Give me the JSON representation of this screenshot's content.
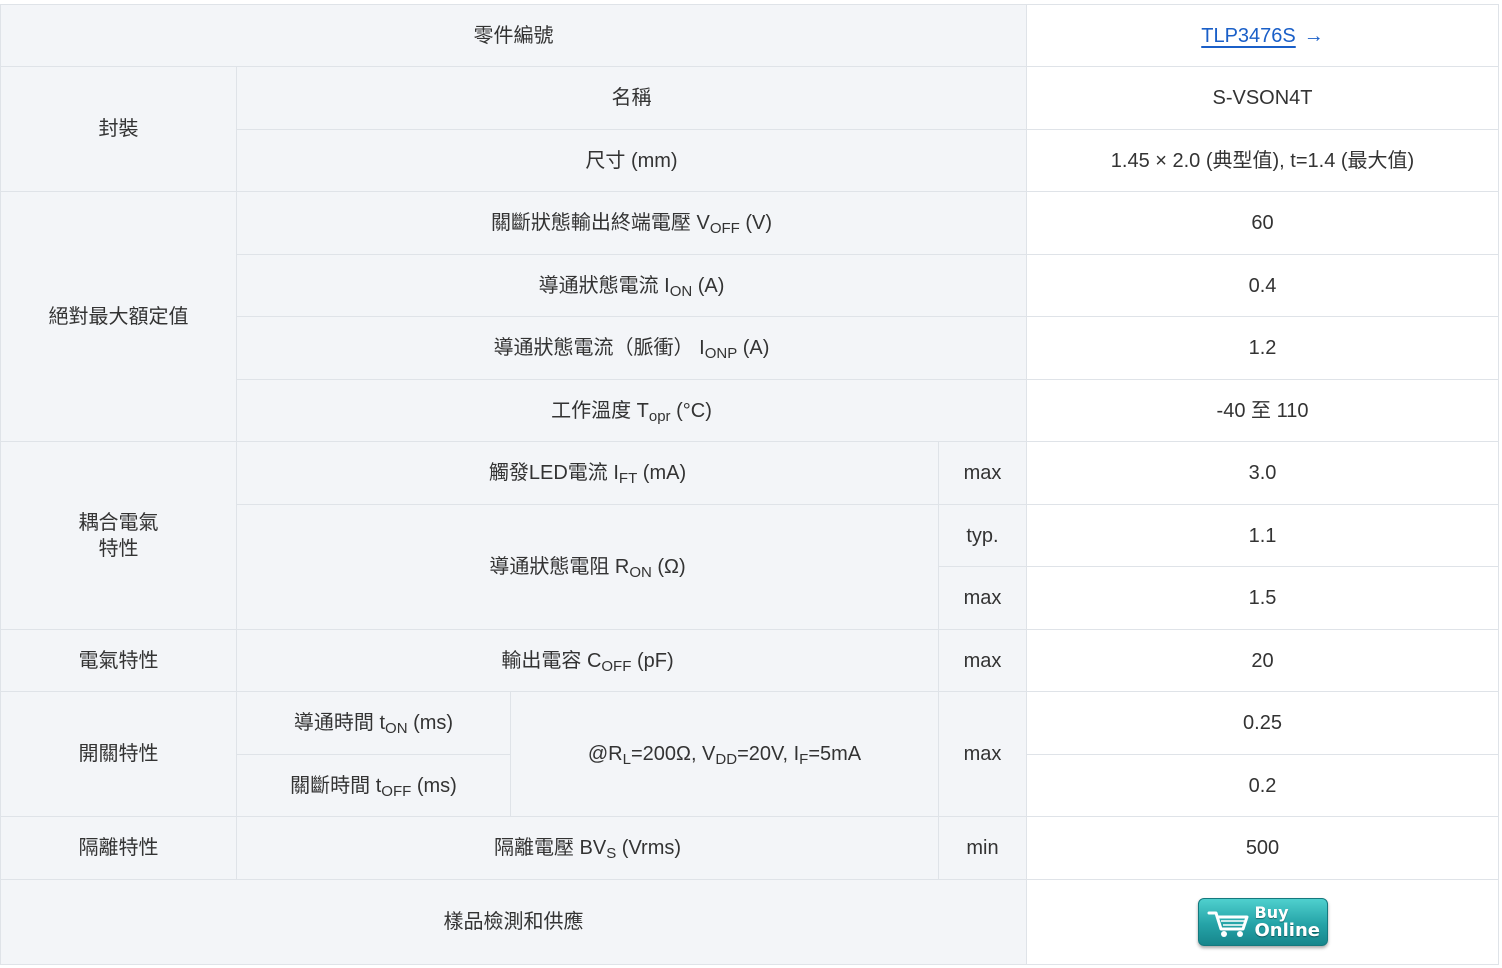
{
  "header": {
    "part_number_label": "零件編號",
    "part_number": "TLP3476S",
    "arrow": "→"
  },
  "package": {
    "group_label": "封裝",
    "name_label": "名稱",
    "name_value": "S-VSON4T",
    "size_label": "尺寸 (mm)",
    "size_value": "1.45 × 2.0 (典型值), t=1.4 (最大值)"
  },
  "absolute_max": {
    "group_label": "絕對最大額定值",
    "voff": {
      "label": "關斷狀態輸出終端電壓 V",
      "sub": "OFF",
      "unit": " (V)",
      "value": "60"
    },
    "ion": {
      "label": "導通狀態電流 I",
      "sub": "ON",
      "unit": " (A)",
      "value": "0.4"
    },
    "ionp": {
      "label": "導通狀態電流（脈衝） I",
      "sub": "ONP",
      "unit": " (A)",
      "value": "1.2"
    },
    "topr": {
      "label": "工作溫度 T",
      "sub": "opr",
      "unit": " (°C)",
      "value": "-40 至 110"
    }
  },
  "coupled": {
    "group_label_line1": "耦合電氣",
    "group_label_line2": "特性",
    "ift": {
      "label": "觸發LED電流 I",
      "sub": "FT",
      "unit": " (mA)",
      "cond": "max",
      "value": "3.0"
    },
    "ron": {
      "label": "導通狀態電阻 R",
      "sub": "ON",
      "unit": " (Ω)",
      "typ_label": "typ.",
      "typ_value": "1.1",
      "max_label": "max",
      "max_value": "1.5"
    }
  },
  "electrical": {
    "group_label": "電氣特性",
    "coff": {
      "label": "輸出電容 C",
      "sub": "OFF",
      "unit": " (pF)",
      "cond": "max",
      "value": "20"
    }
  },
  "switching": {
    "group_label": "開關特性",
    "ton": {
      "label": "導通時間 t",
      "sub": "ON",
      "unit": " (ms)",
      "value": "0.25"
    },
    "toff": {
      "label": "關斷時間 t",
      "sub": "OFF",
      "unit": " (ms)",
      "value": "0.2"
    },
    "condition": {
      "p1": "@R",
      "s1": "L",
      "p2": "=200Ω, V",
      "s2": "DD",
      "p3": "=20V, I",
      "s3": "F",
      "p4": "=5mA"
    },
    "cond": "max"
  },
  "isolation": {
    "group_label": "隔離特性",
    "bvs": {
      "label": "隔離電壓 BV",
      "sub": "S",
      "unit": " (Vrms)",
      "cond": "min",
      "value": "500"
    }
  },
  "sample": {
    "label": "樣品檢測和供應",
    "buy_line1": "Buy",
    "buy_line2": "Online",
    "cart_icon": "shopping-cart-icon"
  },
  "colors": {
    "header_bg": "#f3f5f8",
    "border": "#dfe3e8",
    "link": "#1a5fc8",
    "button": "#25a3a7"
  }
}
